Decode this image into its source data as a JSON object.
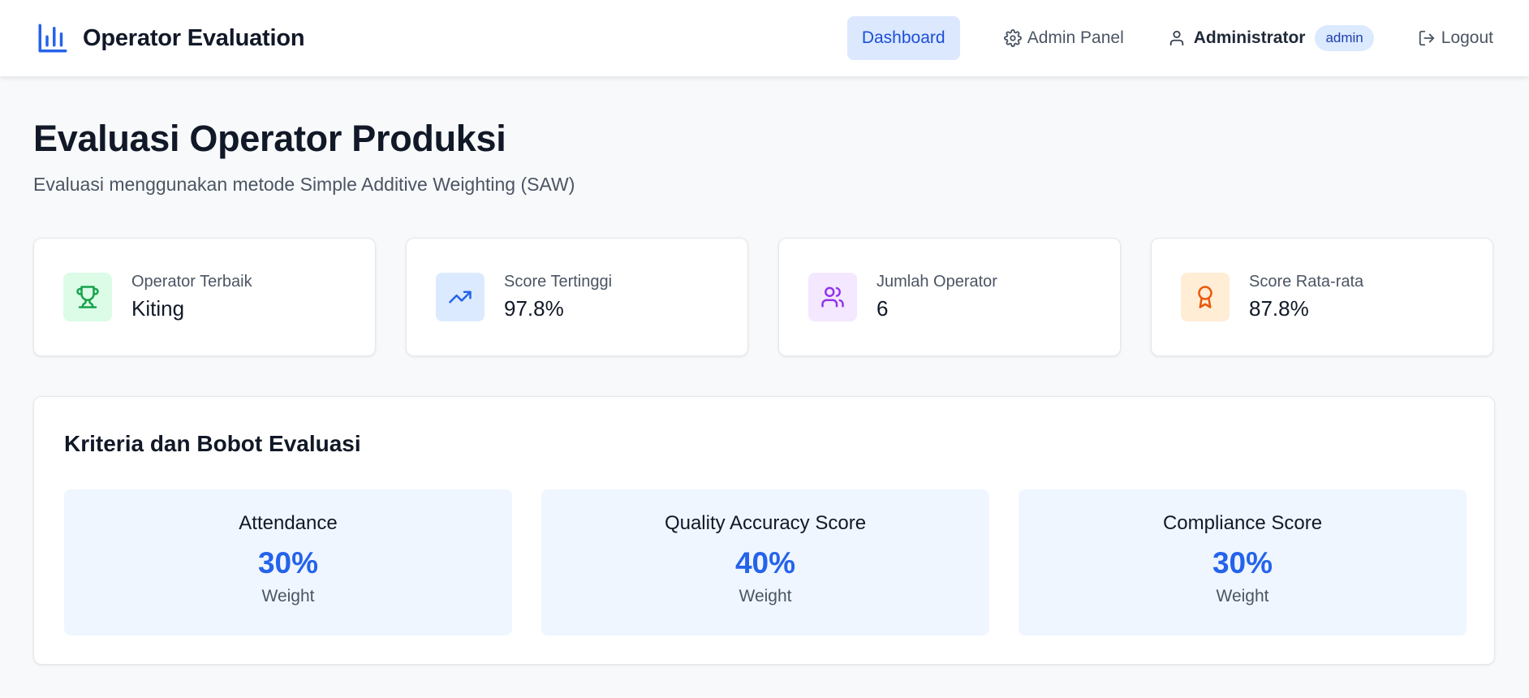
{
  "header": {
    "brand_title": "Operator Evaluation",
    "brand_icon": "bar-chart-icon",
    "nav": {
      "dashboard": "Dashboard",
      "admin_panel": "Admin Panel",
      "logout": "Logout"
    },
    "user": {
      "name": "Administrator",
      "role_badge": "admin"
    }
  },
  "page": {
    "title": "Evaluasi Operator Produksi",
    "subtitle": "Evaluasi menggunakan metode Simple Additive Weighting (SAW)"
  },
  "stats": [
    {
      "label": "Operator Terbaik",
      "value": "Kiting",
      "icon": "trophy-icon",
      "color": "#16a34a",
      "bg": "#dcfce7"
    },
    {
      "label": "Score Tertinggi",
      "value": "97.8%",
      "icon": "trending-up-icon",
      "color": "#2563eb",
      "bg": "#dbeafe"
    },
    {
      "label": "Jumlah Operator",
      "value": "6",
      "icon": "users-icon",
      "color": "#9333ea",
      "bg": "#f3e8ff"
    },
    {
      "label": "Score Rata-rata",
      "value": "87.8%",
      "icon": "award-icon",
      "color": "#ea580c",
      "bg": "#ffedd5"
    }
  ],
  "criteria": {
    "title": "Kriteria dan Bobot Evaluasi",
    "items": [
      {
        "name": "Attendance",
        "weight": "30%",
        "sub": "Weight"
      },
      {
        "name": "Quality Accuracy Score",
        "weight": "40%",
        "sub": "Weight"
      },
      {
        "name": "Compliance Score",
        "weight": "30%",
        "sub": "Weight"
      }
    ]
  },
  "colors": {
    "accent": "#2563eb",
    "nav_active_bg": "#dbe8fe",
    "page_bg": "#f8f9fb"
  }
}
